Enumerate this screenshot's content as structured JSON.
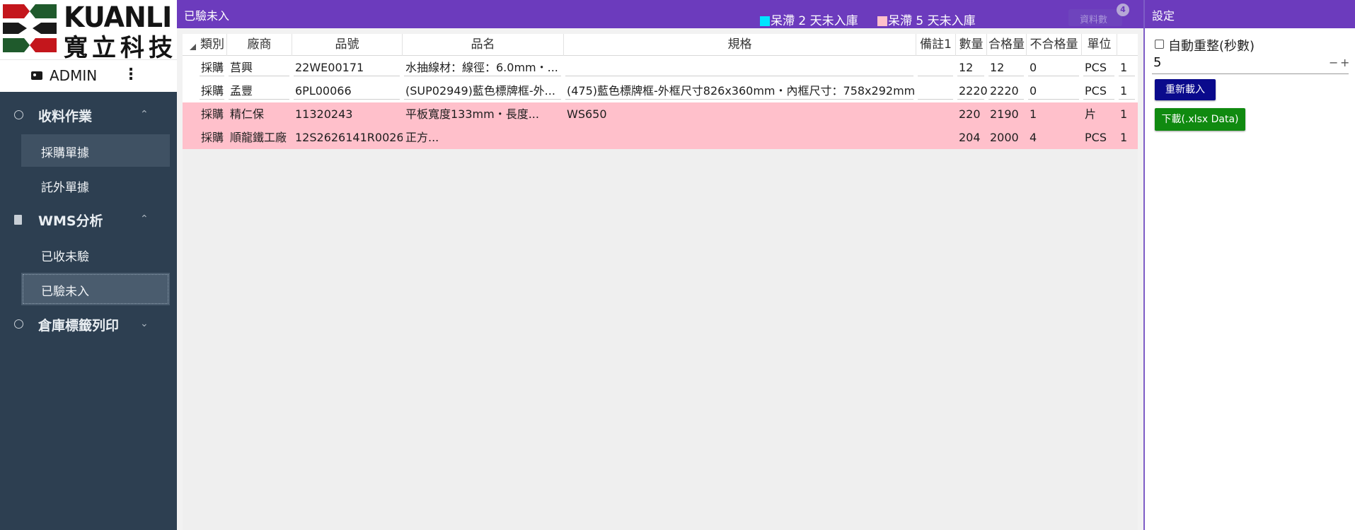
{
  "brand": {
    "name_en": "KUANLI",
    "name_zh": "寬立科技"
  },
  "user": {
    "name": "ADMIN",
    "menu_glyph": "⋮"
  },
  "sidebar": {
    "groups": [
      {
        "label": "收料作業",
        "chevron": "⌃",
        "icon": "clock-icon",
        "items": [
          {
            "label": "採購單據"
          },
          {
            "label": "託外單據"
          }
        ]
      },
      {
        "label": "WMS分析",
        "chevron": "⌃",
        "icon": "document-icon",
        "items": [
          {
            "label": "已收未驗"
          },
          {
            "label": "已驗未入"
          }
        ]
      },
      {
        "label": "倉庫標籤列印",
        "chevron": "⌄",
        "icon": "clock-icon",
        "items": []
      }
    ]
  },
  "main": {
    "title": "已驗未入",
    "legend": [
      {
        "label": "呆滯 2 天未入庫",
        "color": "#00e5ff"
      },
      {
        "label": "呆滯 5 天未入庫",
        "color": "#ffc0cb"
      }
    ],
    "count_label": "資料數",
    "count_value": "4",
    "columns": [
      "類別",
      "廠商",
      "品號",
      "品名",
      "規格",
      "備註1",
      "數量",
      "合格量",
      "不合格量",
      "單位"
    ],
    "rows": [
      {
        "style": "white",
        "cells": [
          "採購",
          "莒興",
          "22WE00171",
          "水抽線材：線徑：6.0mm・...",
          "",
          "",
          "12",
          "12",
          "0",
          "PCS",
          "1"
        ]
      },
      {
        "style": "white",
        "cells": [
          "採購",
          "孟豐",
          "6PL00066",
          "(SUP02949)藍色標牌框-外...",
          "(475)藍色標牌框-外框尺寸826x360mm・內框尺寸：758x292mm",
          "",
          "2220",
          "2220",
          "0",
          "PCS",
          "1"
        ]
      },
      {
        "style": "pink",
        "cells": [
          "採購",
          "精仁保",
          "11320243",
          "平板寬度133mm・長度...",
          "WS650",
          "",
          "220",
          "2190",
          "1",
          "片",
          "1"
        ]
      },
      {
        "style": "pink",
        "cells": [
          "採購",
          "順龍鐵工廠",
          "12S2626141R0026",
          "正方...",
          "",
          "",
          "204",
          "2000",
          "4",
          "PCS",
          "1"
        ]
      }
    ]
  },
  "settings": {
    "title": "設定",
    "auto_reload_label": "自動重整(秒數)",
    "interval_value": "5",
    "minus": "−",
    "plus": "+",
    "reload_button": "重新載入",
    "download_button": "下載(.xlsx Data)"
  },
  "colors": {
    "accent": "#6c3bbd",
    "sidebar_bg": "#2d3f51",
    "overdue_row": "#ffc0cb",
    "reload_btn": "#0a0a8c",
    "download_btn": "#108a10"
  }
}
